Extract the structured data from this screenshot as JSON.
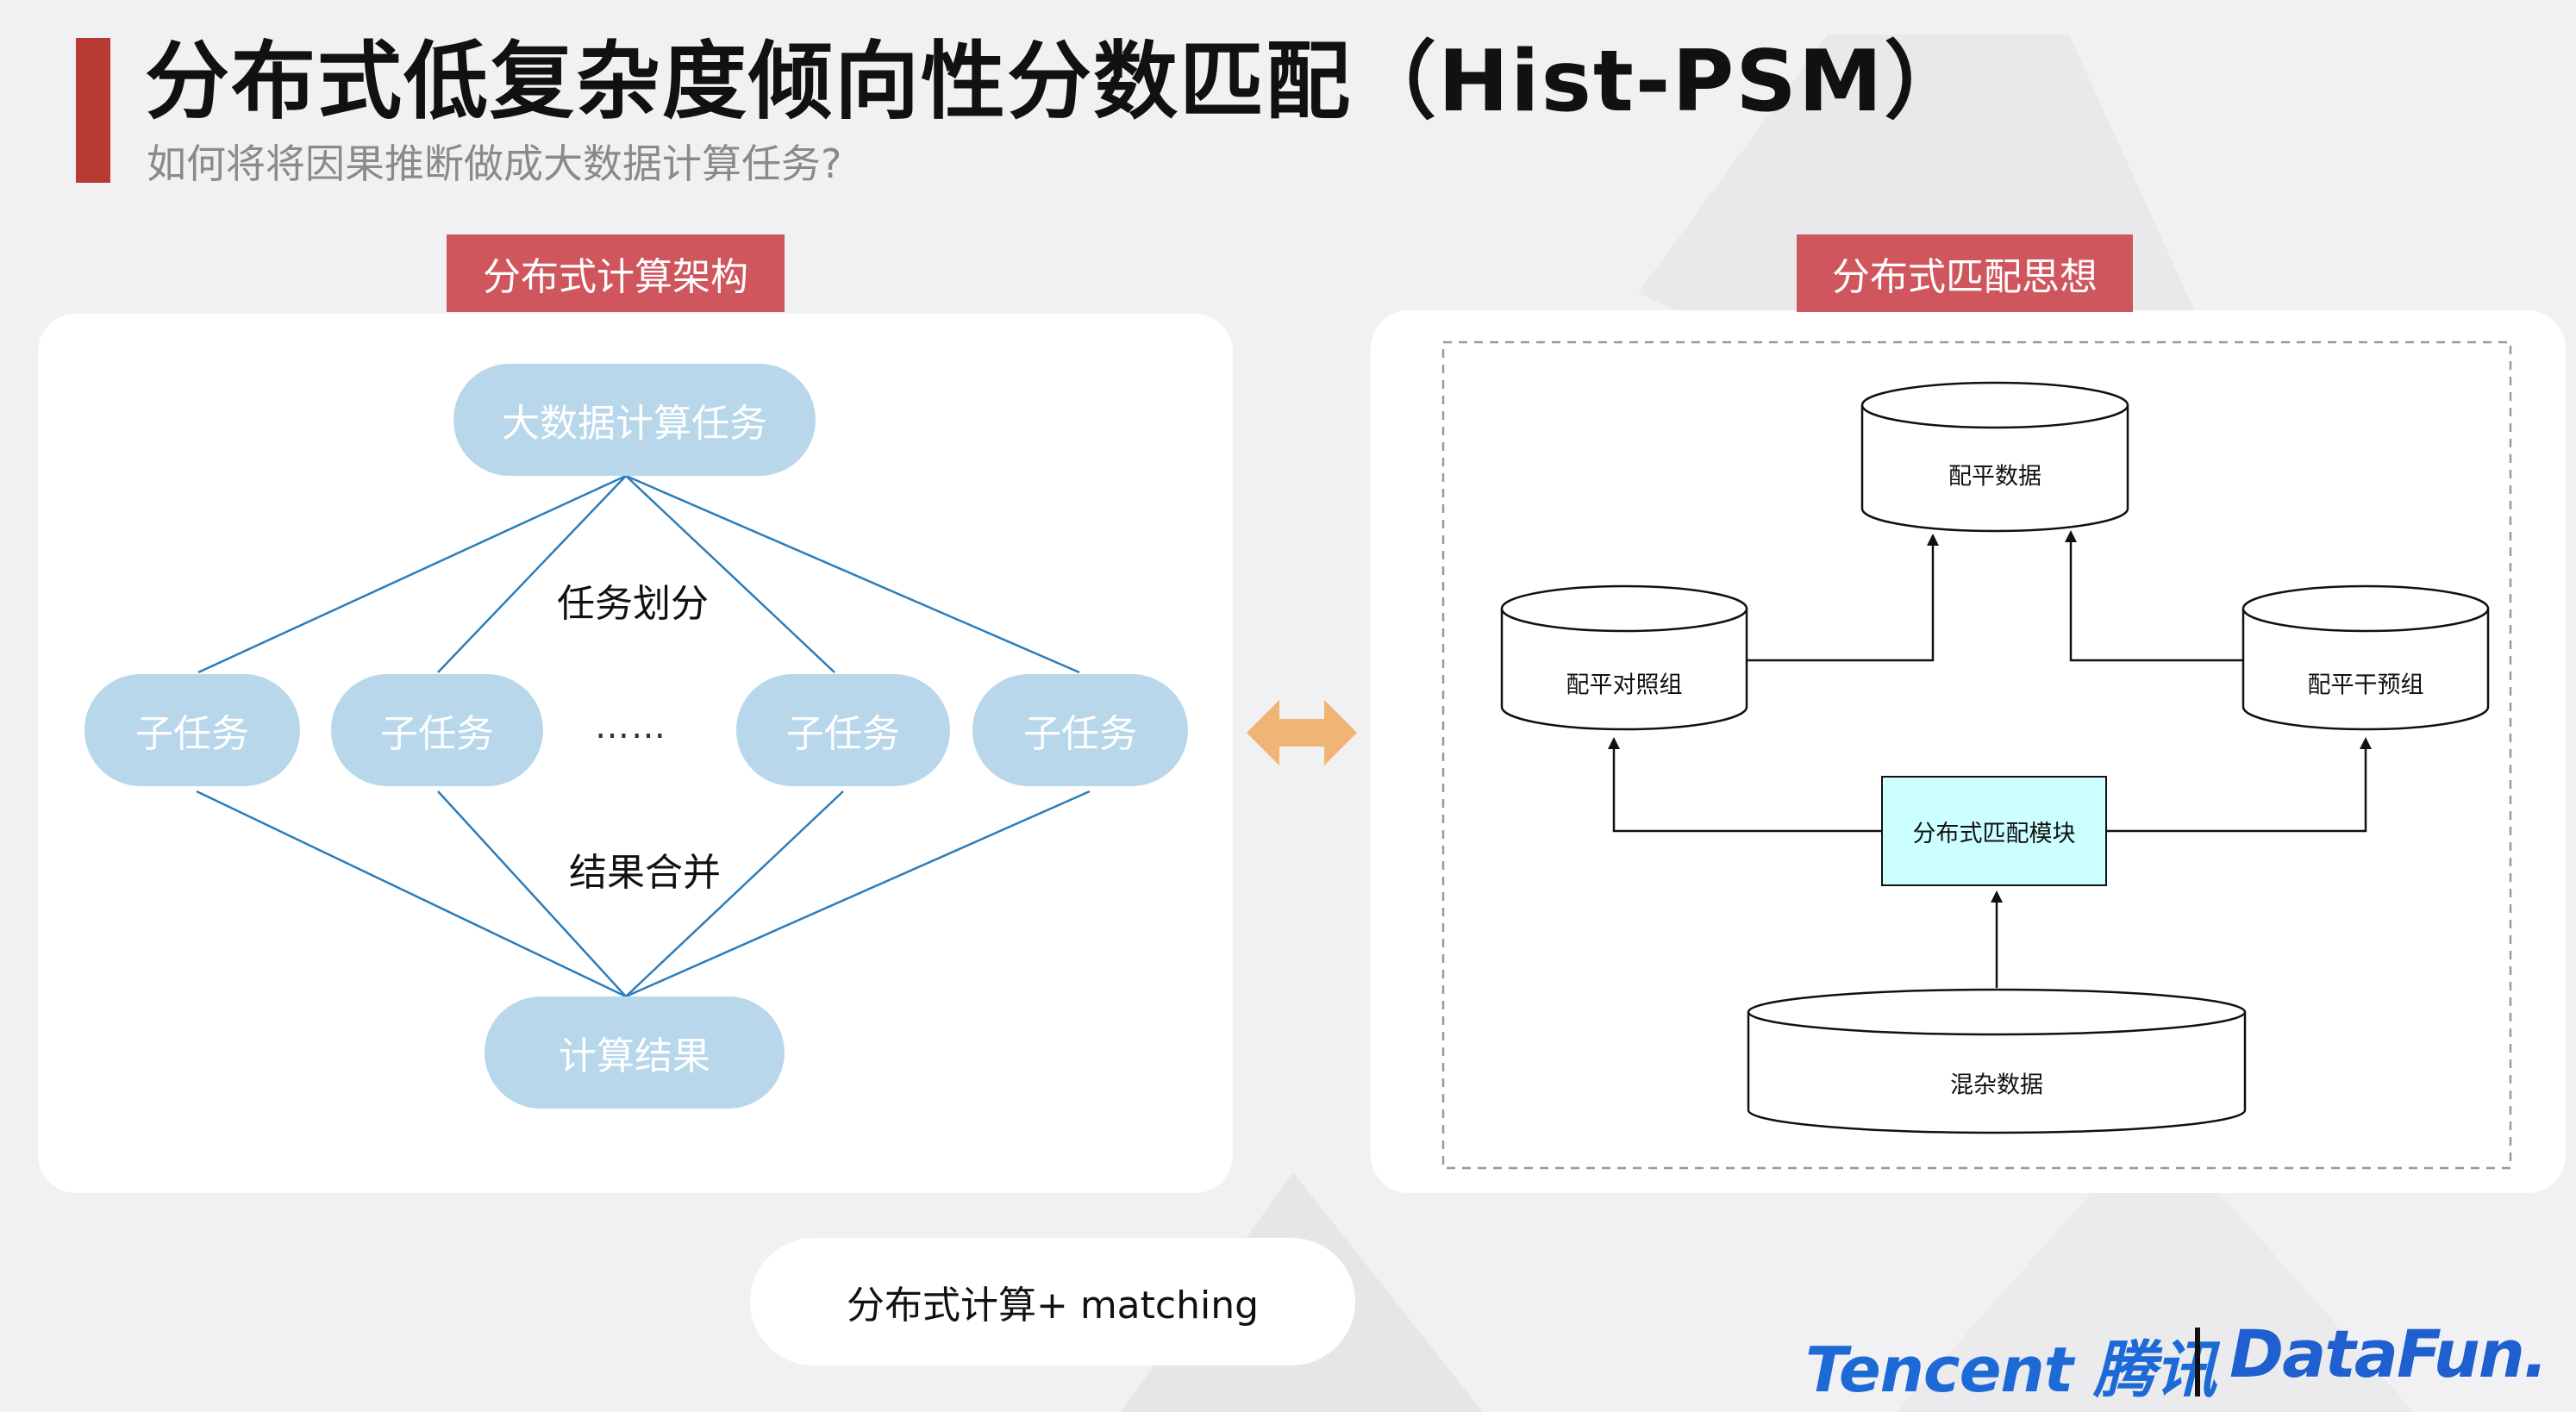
{
  "header": {
    "title": "分布式低复杂度倾向性分数匹配（Hist-PSM）",
    "subtitle": "如何将将因果推断做成大数据计算任务?"
  },
  "left_panel": {
    "tag": "分布式计算架构",
    "top_node": "大数据计算任务",
    "split_label": "任务划分",
    "subtasks": [
      "子任务",
      "子任务",
      "子任务",
      "子任务"
    ],
    "ellipsis": "……",
    "merge_label": "结果合并",
    "bottom_node": "计算结果"
  },
  "right_panel": {
    "tag": "分布式匹配思想",
    "top_db": "配平数据",
    "left_db": "配平对照组",
    "right_db": "配平干预组",
    "module": "分布式匹配模块",
    "bottom_db": "混杂数据"
  },
  "caption": "分布式计算+ matching",
  "logos": {
    "tencent": "Tencent 腾讯",
    "datafun": "DataFun."
  },
  "colors": {
    "accent_red": "#b73a33",
    "tag_red": "#d0565e",
    "pill_blue": "#b8d7ea",
    "line_blue": "#2a7dbd",
    "arrow_orange": "#f0b474",
    "module_cyan": "#ccffff",
    "logo_blue": "#1d6ad6"
  }
}
